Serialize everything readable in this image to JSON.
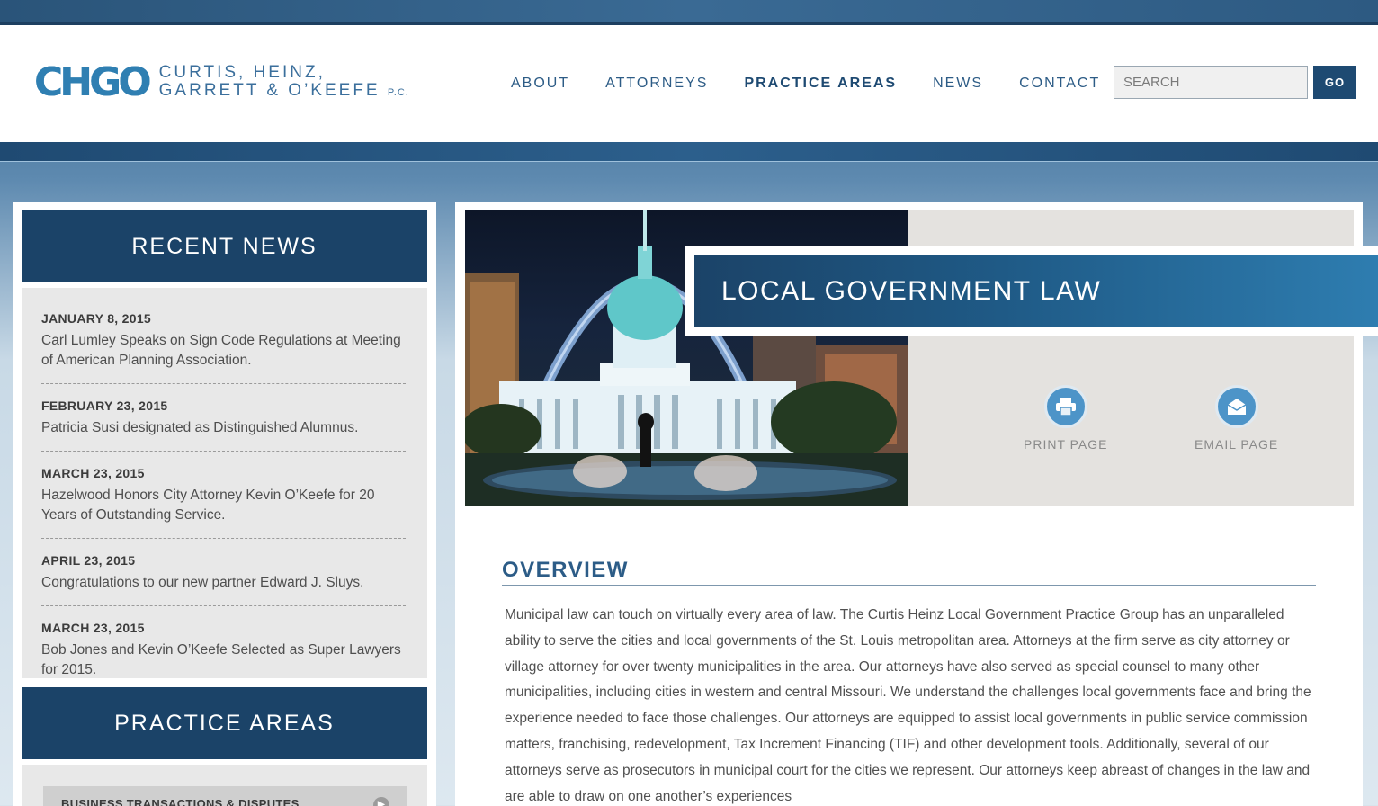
{
  "brand": {
    "logo_mark": "CHGO",
    "name_line1": "CURTIS, HEINZ,",
    "name_line2": "GARRETT & O’KEEFE",
    "suffix": "P.C."
  },
  "nav": {
    "items": [
      "ABOUT",
      "ATTORNEYS",
      "PRACTICE AREAS",
      "NEWS",
      "CONTACT"
    ],
    "active": "PRACTICE AREAS"
  },
  "search": {
    "placeholder": "SEARCH",
    "button": "GO"
  },
  "sidebar": {
    "news_title": "RECENT NEWS",
    "news": [
      {
        "date": "JANUARY 8, 2015",
        "text": "Carl Lumley Speaks on Sign Code Regulations at Meeting of American Planning Association."
      },
      {
        "date": "FEBRUARY 23, 2015",
        "text": "Patricia Susi designated as Distinguished Alumnus."
      },
      {
        "date": "MARCH 23, 2015",
        "text": "Hazelwood Honors City Attorney Kevin O’Keefe for 20 Years of Outstanding Service."
      },
      {
        "date": "APRIL 23, 2015",
        "text": "Congratulations to our new partner Edward J. Sluys."
      },
      {
        "date": "MARCH 23, 2015",
        "text": "Bob Jones and Kevin O’Keefe Selected as Super Lawyers for 2015."
      }
    ],
    "practice_title": "PRACTICE AREAS",
    "practice_items": [
      "BUSINESS TRANSACTIONS & DISPUTES"
    ]
  },
  "hero": {
    "title": "LOCAL GOVERNMENT LAW",
    "print_label": "PRINT PAGE",
    "email_label": "EMAIL PAGE"
  },
  "overview": {
    "heading": "OVERVIEW",
    "body": "Municipal law can touch on virtually every area of law. The Curtis Heinz Local Government Practice Group has an unparalleled ability to serve the cities and local governments of the St. Louis metropolitan area. Attorneys at the firm serve as city attorney or village attorney for over twenty municipalities in the area. Our attorneys have also served as special counsel to many other municipalities, including cities in western and central Missouri. We understand the challenges local governments face and bring the experience needed to face those challenges.  Our attorneys are equipped to assist local governments in public service commission matters, franchising, redevelopment, Tax Increment Financing (TIF) and other development tools. Additionally, several of our attorneys serve as prosecutors in municipal court for the cities we represent. Our attorneys keep abreast of changes in the law and are able to draw on one another’s experiences"
  },
  "colors": {
    "navy": "#1b4368",
    "accent": "#2e7db0",
    "link": "#2d5c86"
  }
}
